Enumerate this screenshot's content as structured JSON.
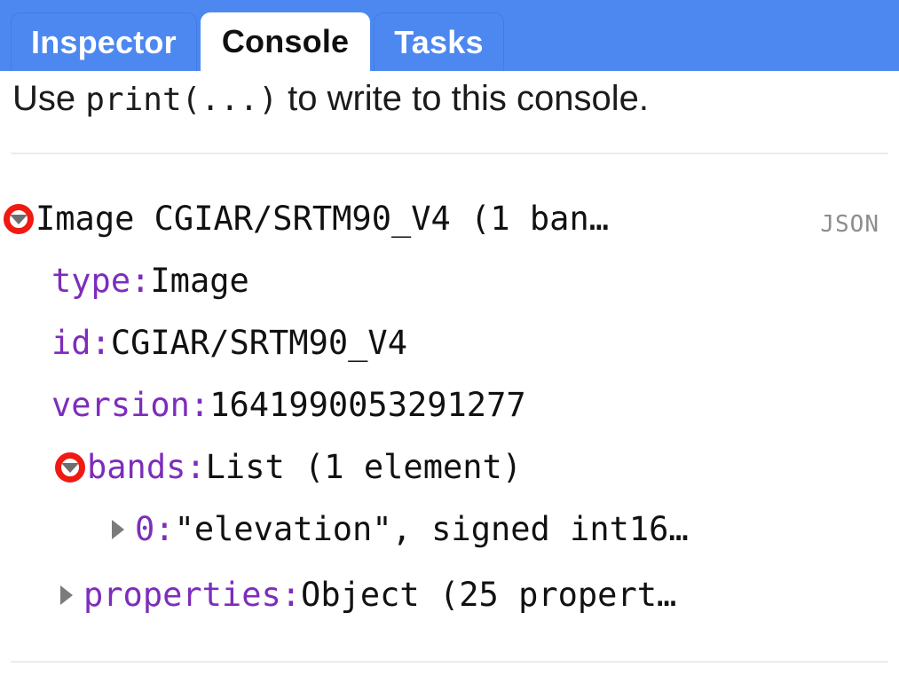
{
  "tabs": [
    {
      "label": "Inspector",
      "active": false
    },
    {
      "label": "Console",
      "active": true
    },
    {
      "label": "Tasks",
      "active": false
    }
  ],
  "console": {
    "hint_prefix": "Use ",
    "hint_code": "print(...)",
    "hint_suffix": " to write to this console.",
    "badge": "JSON"
  },
  "tree": [
    {
      "toggle": "expanded",
      "indent": 0,
      "key": "",
      "key_color": "black",
      "value": "Image CGIAR/SRTM90_V4 (1 ban…"
    },
    {
      "toggle": "none",
      "indent": 1,
      "key": "type:",
      "key_color": "purple",
      "value": " Image"
    },
    {
      "toggle": "none",
      "indent": 1,
      "key": "id:",
      "key_color": "purple",
      "value": " CGIAR/SRTM90_V4"
    },
    {
      "toggle": "none",
      "indent": 1,
      "key": "version:",
      "key_color": "purple",
      "value": " 1641990053291277"
    },
    {
      "toggle": "expanded",
      "indent": 2,
      "key": "bands:",
      "key_color": "purple",
      "value": " List (1 element)"
    },
    {
      "toggle": "collapsed",
      "indent": 3,
      "key": "0:",
      "key_color": "purple",
      "value": " \"elevation\", signed int16…"
    },
    {
      "toggle": "collapsed",
      "indent": 2,
      "key": "properties:",
      "key_color": "purple",
      "value": " Object (25 propert…"
    }
  ],
  "colors": {
    "tabbar_blue": "#4d88f0",
    "tab_border": "#3f7ce8",
    "key_purple": "#7d2dbb",
    "toggle_red": "#f01a12",
    "triangle_gray": "#7b7b7b",
    "divider": "#ebebeb"
  }
}
